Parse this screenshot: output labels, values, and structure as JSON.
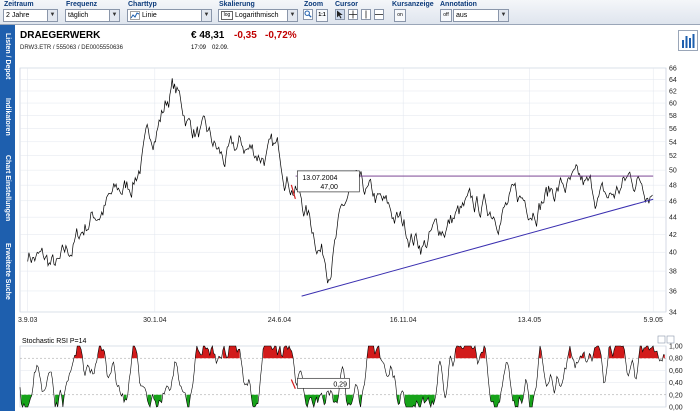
{
  "toolbar": {
    "zeitraum": {
      "label": "Zeitraum",
      "value": "2 Jahre"
    },
    "frequenz": {
      "label": "Frequenz",
      "value": "täglich"
    },
    "charttyp": {
      "label": "Charttyp",
      "value": "Linie"
    },
    "skalierung": {
      "label": "Skalierung",
      "badge": "log",
      "value": "Logarithmisch"
    },
    "zoom": {
      "label": "Zoom",
      "ratio": "1:1"
    },
    "cursor": {
      "label": "Cursor"
    },
    "kursanzeige": {
      "label": "Kursanzeige",
      "state": "on"
    },
    "annotation": {
      "label": "Annotation",
      "state": "off",
      "value": "aus"
    }
  },
  "sidebar": {
    "items": [
      {
        "label": "Listen / Depot"
      },
      {
        "label": "Indikatoren"
      },
      {
        "label": "Chart Einstellungen"
      },
      {
        "label": "Erweiterte Suche"
      }
    ]
  },
  "header": {
    "name": "DRAEGERWERK",
    "ids": "DRW3.ETR  /  555063  /  DE0005550636",
    "price": "€ 48,31",
    "change_abs": "-0,35",
    "change_pct": "-0,72%",
    "time": "17:09",
    "date": "02.09."
  },
  "colors": {
    "sidebar": "#1e5fae",
    "price_line": "#000000",
    "trend_line": "#3a2fb0",
    "resistance_line": "#6a2c86",
    "negative": "#c00000",
    "rsi_overbought": "#d21a1a",
    "rsi_oversold": "#17a31a"
  },
  "chart_data": [
    {
      "type": "line",
      "title": "",
      "scale": "log",
      "ylim": [
        34,
        66
      ],
      "yticks": [
        "34",
        "36",
        "38",
        "40",
        "42",
        "44",
        "46",
        "48",
        "50",
        "52",
        "54",
        "56",
        "58",
        "60",
        "62",
        "64",
        "66"
      ],
      "xtick_labels": [
        "3.9.03",
        "30.1.04",
        "24.6.04",
        "16.11.04",
        "13.4.05",
        "5.9.05"
      ],
      "annotation": {
        "date": "13.07.2004",
        "value": "47,00"
      },
      "series": [
        {
          "x": [
            "3.9.03",
            "10.10.03",
            "15.11.03",
            "1.1.04",
            "30.1.04",
            "20.2.04",
            "10.3.04",
            "1.4.04",
            "20.4.04",
            "10.5.04",
            "24.6.04",
            "13.7.04",
            "1.8.04",
            "20.8.04",
            "15.9.04",
            "10.10.04",
            "16.11.04",
            "10.12.04",
            "15.1.05",
            "15.2.05",
            "13.4.05",
            "20.5.05",
            "20.6.05",
            "15.7.05",
            "10.8.05",
            "5.9.05"
          ],
          "y": [
            40,
            38,
            44,
            48,
            56,
            63,
            57,
            54,
            51,
            53,
            52,
            48,
            43,
            39,
            47,
            46,
            43,
            41,
            44,
            45,
            46,
            48,
            47,
            46,
            49,
            48.3
          ]
        }
      ],
      "lines": [
        {
          "name": "",
          "from": {
            "x": "20.7.04",
            "y": 35.5
          },
          "to": {
            "x": "5.9.05",
            "y": 46.2
          }
        },
        {
          "name": "",
          "from": {
            "x": "13.7.04",
            "y": 49.2
          },
          "to": {
            "x": "5.9.05",
            "y": 49.2
          }
        }
      ]
    },
    {
      "type": "line",
      "title": "Stochastic RSI P=14",
      "ylim": [
        0,
        1
      ],
      "yticks": [
        "0,00",
        "0,20",
        "0,40",
        "0,60",
        "0,80",
        "1,00"
      ],
      "annotation": {
        "value": "0,29"
      },
      "overbought": 0.8,
      "oversold": 0.2
    }
  ]
}
